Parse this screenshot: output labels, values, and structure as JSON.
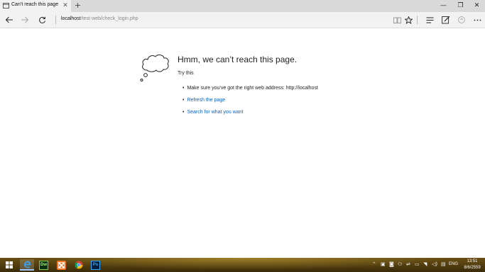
{
  "tab": {
    "title": "Can’t reach this page",
    "close": "✕",
    "new_tab": "+"
  },
  "window_controls": {
    "minimize": "—",
    "maximize": "❐",
    "close": "✕"
  },
  "address": {
    "host": "localhost",
    "path": "/test-web/check_login.php"
  },
  "error": {
    "title": "Hmm, we can’t reach this page.",
    "try_this": "Try this",
    "suggestions": [
      "Make sure you’ve got the right web address: http://localhost",
      "Refresh the page",
      "Search for what you want"
    ]
  },
  "taskbar": {
    "apps": [
      "start-icon",
      "edge-icon",
      "dreamweaver-icon",
      "xampp-icon",
      "chrome-icon",
      "photoshop-icon"
    ],
    "dw_label": "Dw",
    "ps_label": "Ps",
    "language": "ENG",
    "time": "13:51",
    "date": "8/6/2559"
  },
  "colors": {
    "link": "#0a62c9",
    "tabstrip": "#d9d9d9",
    "navbar": "#f2f2f2"
  }
}
